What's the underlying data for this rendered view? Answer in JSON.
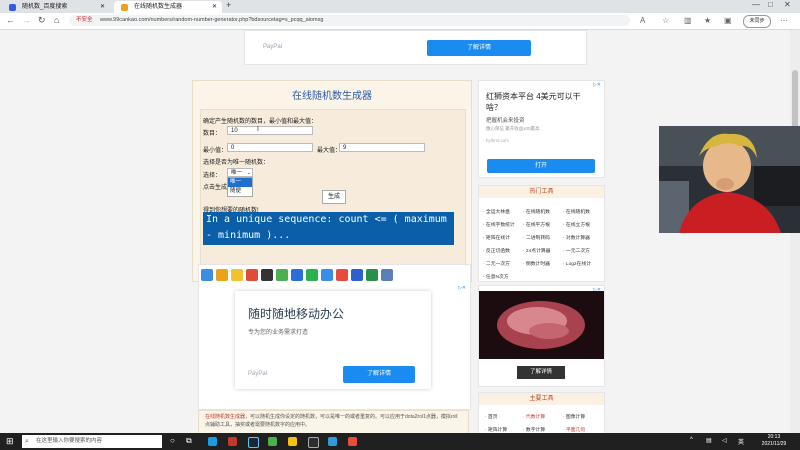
{
  "browser": {
    "tabs": [
      {
        "label": "随机数_百度搜索",
        "active": false
      },
      {
        "label": "在线随机数生成器",
        "active": true
      }
    ],
    "security_label": "不安全",
    "url": "www.99cankao.com/numbers/random-number-generator.php?bdsourcetag=s_pcqq_aiomsg",
    "sync_label": "未同步"
  },
  "top_ad": {
    "brand": "PayPal",
    "button_label": "了解详情"
  },
  "generator": {
    "title": "在线随机数生成器",
    "intro": "确定产生随机数的数目，最小值和最大值：",
    "count_label": "数目：",
    "count_value": "10",
    "min_label": "最小值：",
    "min_value": "0",
    "max_label": "最大值：",
    "max_value": "9",
    "unique_prompt": "选择是否为唯一随机数：",
    "select_label": "选择：",
    "select_value": "唯一",
    "dropdown_options": [
      "唯一",
      "随便"
    ],
    "click_label": "点击生成",
    "generate_label": "生成",
    "result_label": "得到你想要的随机数!",
    "result_text": "In a unique sequence: count <= ( maximum - minimum )..."
  },
  "share_icons": [
    "plus-icon",
    "star-icon",
    "qzone-icon",
    "weibo-icon",
    "qq-icon",
    "clover-icon",
    "renren-icon",
    "wechat-icon",
    "tencent-weibo-icon",
    "bookmark-icon",
    "baidu-icon",
    "douban-icon",
    "print-icon"
  ],
  "share_colors": [
    "#3a8de0",
    "#e8a21b",
    "#f2c12e",
    "#e04b3a",
    "#333333",
    "#4caf50",
    "#2a6fd6",
    "#2bb24c",
    "#3c8de8",
    "#e84c3d",
    "#2d5fd0",
    "#2a8f4a",
    "#5b7fb8"
  ],
  "mid_ad": {
    "headline": "随时随地移动办公",
    "sub": "专为您的业务需求打造",
    "brand": "PayPal",
    "button_label": "了解详情"
  },
  "description": {
    "highlight": "在线随机数生成器",
    "text": "，可以随机生成你设定的随机数，可以是唯一的或者重复的。可以应用于dota2rol1点器，模拟roll点辅助工具，抽奖或者需要随机数字的应用中。"
  },
  "right_ad": {
    "headline": "红狮资本平台 4美元可以干啥？",
    "sub": "把握机会来投资",
    "meta": "缴心保证 聚开收益x00赢高",
    "domain": "hylhmr.com",
    "button_label": "打开"
  },
  "hot_tools": {
    "title": "热门工具",
    "items": [
      "· 全运大林盘",
      "· 在线随机数",
      "· 在线随机数",
      "· 在线字数统计",
      "· 在线平方根",
      "· 在线立方根",
      "· 矩阵在线计",
      "· 二进制转码",
      "· 对数计算器",
      "· 反正切函数",
      "· 24点计算器",
      "· 一元二次方",
      "· 二元一次方",
      "· 倒数计时器",
      "· Log2在线计",
      "· 任意N次方"
    ]
  },
  "right_ad2": {
    "button_label": "了解详情"
  },
  "main_tools": {
    "title": "主要工具",
    "items": [
      "· 首页",
      "· 代数计算",
      "· 图像计算",
      "· 矩阵计算",
      "· 数字计算",
      "· 平面几何"
    ]
  },
  "taskbar": {
    "search_placeholder": "在这里输入你要搜索的内容",
    "time": "20:13",
    "date": "2021/11/29"
  },
  "colors": {
    "accent_blue": "#1a8bf0",
    "code_bg": "#0b5ea8",
    "title_blue": "#2d5aa8",
    "hot_red": "#c24b24"
  }
}
